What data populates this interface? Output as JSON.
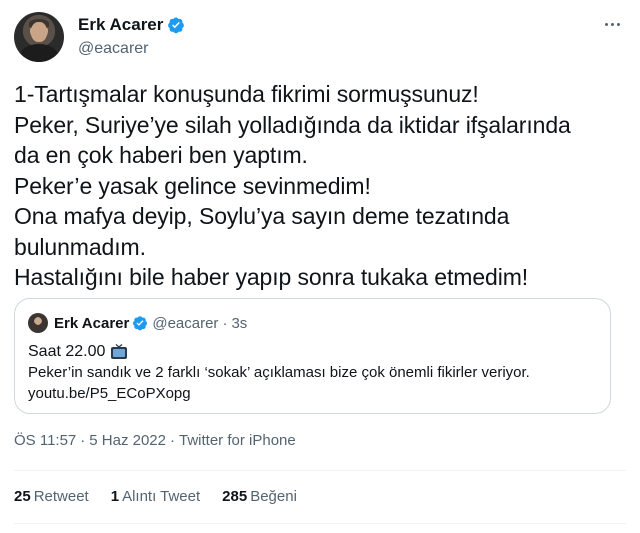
{
  "author": {
    "display_name": "Erk Acarer",
    "handle": "@eacarer",
    "verified": true,
    "avatar_icon": "profile-photo",
    "more_icon": "more-horizontal-icon"
  },
  "tweet": {
    "lines": [
      "1-Tartışmalar konuşunda fikrimi sormuşsunuz!",
      "Peker, Suriye’ye silah yolladığında da iktidar ifşalarında",
      "da en çok haberi ben yaptım.",
      "Peker’e yasak gelince sevinmedim!",
      "Ona mafya deyip, Soylu’ya sayın deme tezatında",
      "bulunmadım.",
      "Hastalığını bile haber yapıp sonra tukaka etmedim!"
    ]
  },
  "quoted_tweet": {
    "display_name": "Erk Acarer",
    "handle": "@eacarer",
    "separator": "·",
    "time": "3s",
    "line1": "Saat 22.00",
    "line1_icon": "television-icon",
    "line2": "Peker’in sandık ve 2 farklı ‘sokak’ açıklaması bize çok önemli fikirler veriyor.",
    "line3": "youtu.be/P5_ECoPXopg"
  },
  "meta": {
    "time": "ÖS 11:57",
    "separator": "·",
    "date": "5 Haz 2022",
    "source": "Twitter for iPhone"
  },
  "stats": {
    "retweets_count": "25",
    "retweets_label": "Retweet",
    "quotes_count": "1",
    "quotes_label": "Alıntı Tweet",
    "likes_count": "285",
    "likes_label": "Beğeni"
  },
  "colors": {
    "verified_blue": "#1d9bf0",
    "text_primary": "#0f1419",
    "text_secondary": "#536471",
    "border": "#cfd9de"
  }
}
